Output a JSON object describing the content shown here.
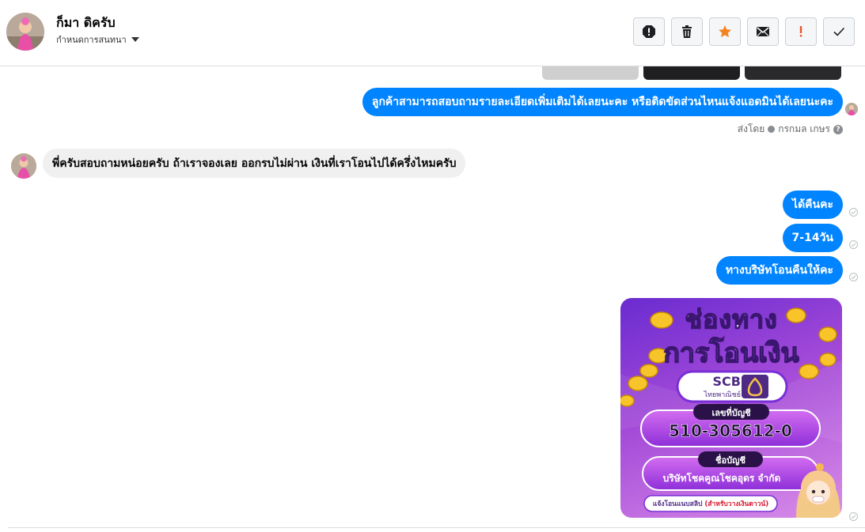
{
  "header": {
    "contact_name": "ก็มา ดิครับ",
    "conversation_settings": "กำหนดการสนทนา",
    "tools": [
      {
        "name": "report-spam-icon"
      },
      {
        "name": "trash-icon"
      },
      {
        "name": "star-icon"
      },
      {
        "name": "mark-unread-icon"
      },
      {
        "name": "mark-important-icon"
      },
      {
        "name": "done-check-icon"
      }
    ]
  },
  "messages": {
    "out_1": "ลูกค้าสามารถสอบถามรายละเอียดเพิ่มเติมได้เลยนะคะ หรือติดขัดส่วนไหนแจ้งแอดมินได้เลยนะคะ",
    "sent_by_prefix": "ส่งโดย",
    "sent_by_name": "กรกมล เกษร",
    "in_1": "พี่ครับสอบถามหน่อยครับ ถ้าเราจองเลย ออกรบไม่ผ่าน  เงินที่เราโอนไปได้ครึ่งไหมครับ",
    "out_2": "ได้คืนคะ",
    "out_3": "7-14วัน",
    "out_4": "ทางบริษัทโอนคืนให้คะ"
  },
  "poster": {
    "title_line1": "ช่องทาง",
    "title_line2": "การโอนเงิน",
    "bank_code": "SCB",
    "bank_name": "ไทยพาณิชย์",
    "account_label": "เลขที่บัญชี",
    "account_number": "510-305612-0",
    "account_name_label": "ชื่อบัญชี",
    "account_name": "บริษัทโชคคูณโชคอุดร จำกัด",
    "footer_prefix": "แจ้งโอนแนบสลิป ",
    "footer_note": "(สำหรับวางเงินดาวน์)"
  },
  "colors": {
    "outgoing_bubble": "#0084ff",
    "incoming_bubble": "#f0f0f0",
    "star": "#f5821f",
    "important": "#e4572e",
    "poster_purple": "#7a2fd6"
  }
}
